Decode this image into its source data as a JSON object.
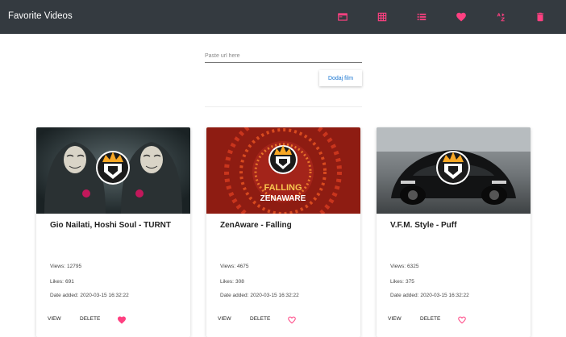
{
  "app": {
    "title": "Favorite Videos"
  },
  "toolbar": {
    "accent_color": "#ff4081",
    "icons": [
      {
        "name": "card-view-icon"
      },
      {
        "name": "grid-view-icon"
      },
      {
        "name": "list-view-icon"
      },
      {
        "name": "favorites-heart-icon"
      },
      {
        "name": "sort-az-icon"
      },
      {
        "name": "trash-icon"
      }
    ]
  },
  "form": {
    "url_placeholder": "Paste url here",
    "url_value": "",
    "add_button_label": "Dodaj film"
  },
  "cards": [
    {
      "title": "Gio Nailati, Hoshi Soul - TURNT",
      "views_label": "Views:",
      "views": "12795",
      "likes_label": "Likes:",
      "likes": "691",
      "date_label": "Date added:",
      "date": "2020-03-15 16:32:22",
      "view_label": "VIEW",
      "delete_label": "DELETE",
      "favorite": true
    },
    {
      "title": "ZenAware - Falling",
      "thumb_text_1": "FALLING",
      "thumb_text_2": "ZENAWARE",
      "views_label": "Views:",
      "views": "4675",
      "likes_label": "Likes:",
      "likes": "308",
      "date_label": "Date added:",
      "date": "2020-03-15 16:32:22",
      "view_label": "VIEW",
      "delete_label": "DELETE",
      "favorite": false
    },
    {
      "title": "V.F.M. Style - Puff",
      "views_label": "Views:",
      "views": "6325",
      "likes_label": "Likes:",
      "likes": "375",
      "date_label": "Date added:",
      "date": "2020-03-15 16:32:22",
      "view_label": "VIEW",
      "delete_label": "DELETE",
      "favorite": false
    }
  ]
}
